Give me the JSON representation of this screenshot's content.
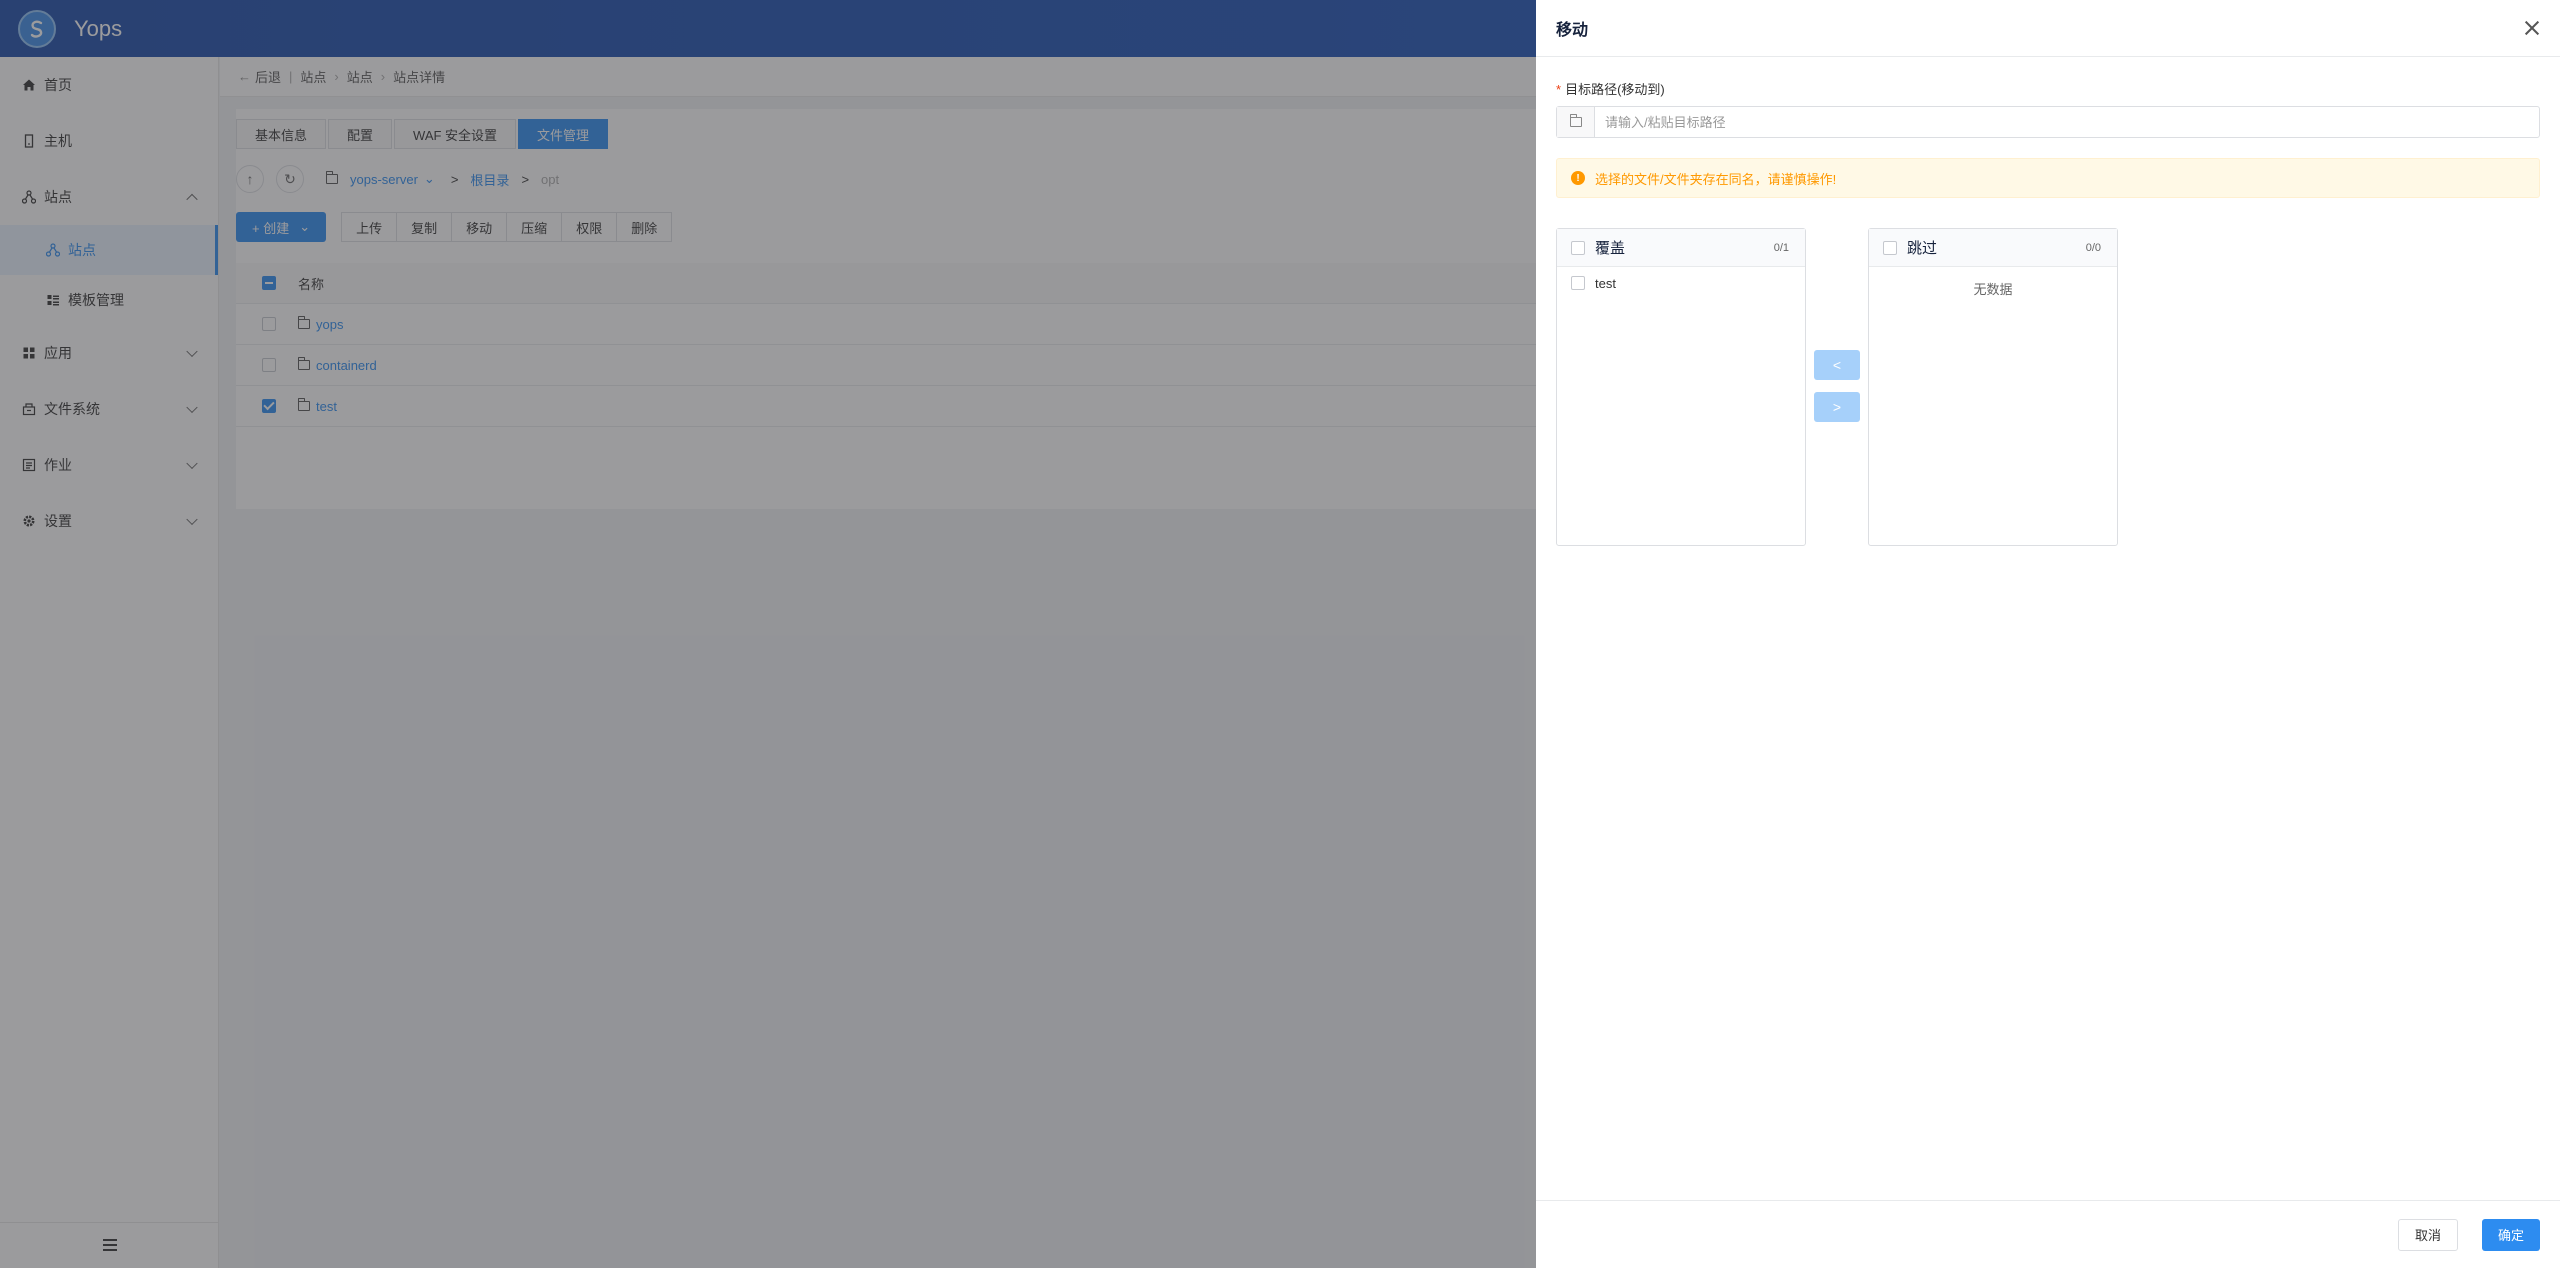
{
  "app": {
    "brand": "Yops"
  },
  "sidebar": {
    "items": [
      {
        "label": "首页",
        "icon": "home-icon"
      },
      {
        "label": "主机",
        "icon": "server-icon"
      },
      {
        "label": "站点",
        "icon": "sitemap-icon",
        "expanded": true
      },
      {
        "label": "站点",
        "icon": "sitemap-icon",
        "active": true
      },
      {
        "label": "模板管理",
        "icon": "template-icon"
      },
      {
        "label": "应用",
        "icon": "apps-icon"
      },
      {
        "label": "文件系统",
        "icon": "filesystem-icon"
      },
      {
        "label": "作业",
        "icon": "job-icon"
      },
      {
        "label": "设置",
        "icon": "gear-icon"
      }
    ]
  },
  "breadcrumb": {
    "back": "后退",
    "items": [
      "站点",
      "站点",
      "站点详情"
    ]
  },
  "tabs": [
    {
      "label": "基本信息"
    },
    {
      "label": "配置"
    },
    {
      "label": "WAF 安全设置"
    },
    {
      "label": "文件管理",
      "active": true
    }
  ],
  "path": {
    "server": "yops-server",
    "root": "根目录",
    "current": "opt"
  },
  "toolbar": {
    "create": "+ 创建",
    "buttons": [
      "上传",
      "复制",
      "移动",
      "压缩",
      "权限",
      "删除"
    ]
  },
  "table": {
    "header": "名称",
    "rows": [
      {
        "name": "yops",
        "checked": false
      },
      {
        "name": "containerd",
        "checked": false
      },
      {
        "name": "test",
        "checked": true
      }
    ]
  },
  "drawer": {
    "title": "移动",
    "field_label": "目标路径(移动到)",
    "required_mark": "*",
    "input_value": "",
    "input_placeholder": "请输入/粘贴目标路径",
    "alert": "选择的文件/文件夹存在同名，请谨慎操作!",
    "left": {
      "title": "覆盖",
      "count": "0/1",
      "items": [
        "test"
      ]
    },
    "right": {
      "title": "跳过",
      "count": "0/0",
      "empty": "无数据"
    },
    "op_left": "<",
    "op_right": ">",
    "cancel": "取消",
    "ok": "确定"
  },
  "colors": {
    "primary": "#2d8cf0",
    "topbar": "#1a4aa8",
    "warning": "#ff9900"
  }
}
